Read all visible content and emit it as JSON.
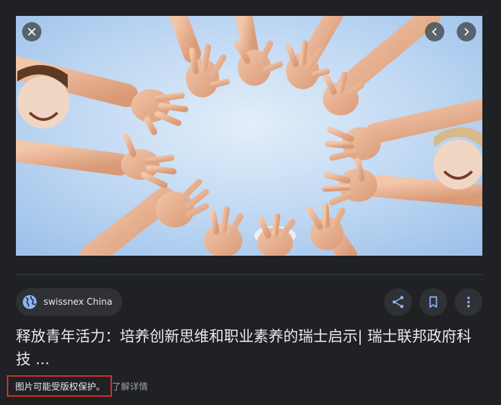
{
  "viewer": {
    "close_icon": "close-icon",
    "prev_icon": "chevron-left-icon",
    "next_icon": "chevron-right-icon"
  },
  "source": {
    "icon": "globe-icon",
    "name": "swissnex China"
  },
  "actions": {
    "share_icon": "share-icon",
    "save_icon": "bookmark-icon",
    "more_icon": "more-vert-icon"
  },
  "title": "释放青年活力：培养创新思维和职业素养的瑞士启示| 瑞士联邦政府科技 ...",
  "copyright": {
    "notice": "图片可能受版权保护。",
    "learn_more": "了解详情"
  },
  "colors": {
    "background": "#202124",
    "chip_background": "#303134",
    "accent_blue": "#8ab4f8",
    "highlight_red": "#d93025"
  }
}
